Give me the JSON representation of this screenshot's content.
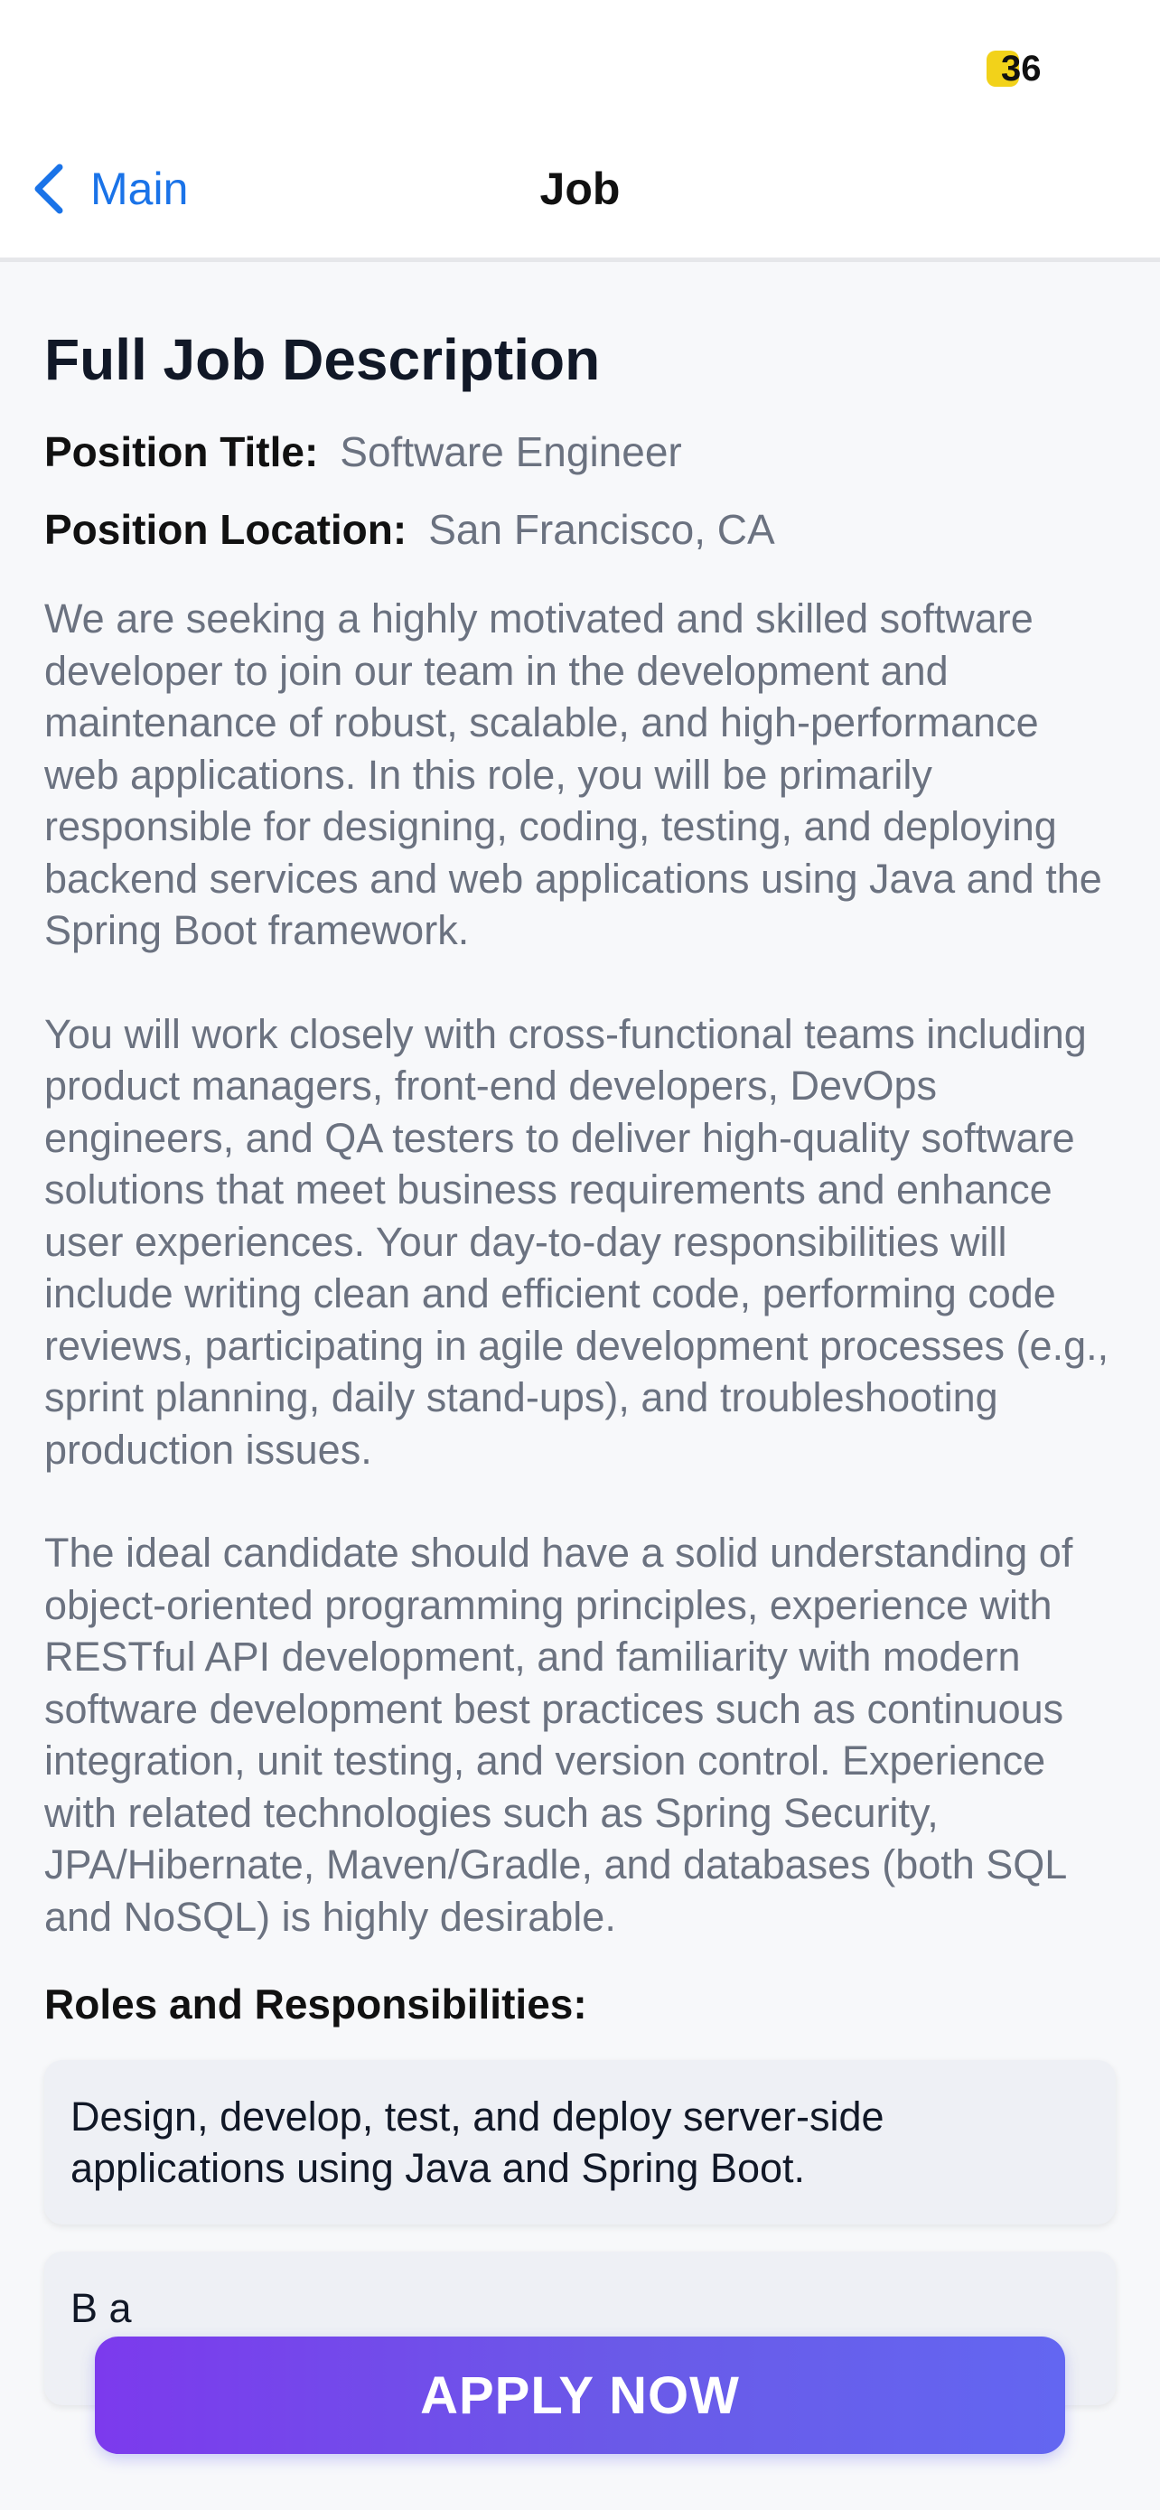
{
  "status_bar": {
    "battery_level": "36",
    "battery_color": "#f2d21a"
  },
  "nav": {
    "back_label": "Main",
    "back_icon": "chevron-left-icon",
    "title": "Job",
    "accent_color": "#1a73e8"
  },
  "job": {
    "heading": "Full Job Description",
    "position_title_label": "Position Title:",
    "position_title": "Software Engineer",
    "position_location_label": "Position Location:",
    "position_location": "San Francisco, CA",
    "description": [
      "We are seeking a highly motivated and skilled software developer to join our team in the development and maintenance of robust, scalable, and high-performance web applications. In this role, you will be primarily responsible for designing, coding, testing, and deploying backend services and web applications using Java and the Spring Boot framework.",
      "You will work closely with cross-functional teams including product managers, front-end developers, DevOps engineers, and QA testers to deliver high-quality software solutions that meet business requirements and enhance user experiences. Your day-to-day responsibilities will include writing clean and efficient code, performing code reviews, participating in agile development processes (e.g., sprint planning, daily stand-ups), and troubleshooting production issues.",
      "The ideal candidate should have a solid understanding of object-oriented programming principles, experience with RESTful API development, and familiarity with modern software development best practices such as continuous integration, unit testing, and version control. Experience with related technologies such as Spring Security, JPA/Hibernate, Maven/Gradle, and databases (both SQL and NoSQL) is highly desirable."
    ],
    "roles_title": "Roles and Responsibilities:",
    "roles": [
      "Design, develop, test, and deploy server-side applications using Java and Spring Boot.",
      "B a"
    ]
  },
  "apply_button": {
    "label": "APPLY NOW",
    "gradient_start": "#7c3aed",
    "gradient_end": "#6366f1"
  }
}
